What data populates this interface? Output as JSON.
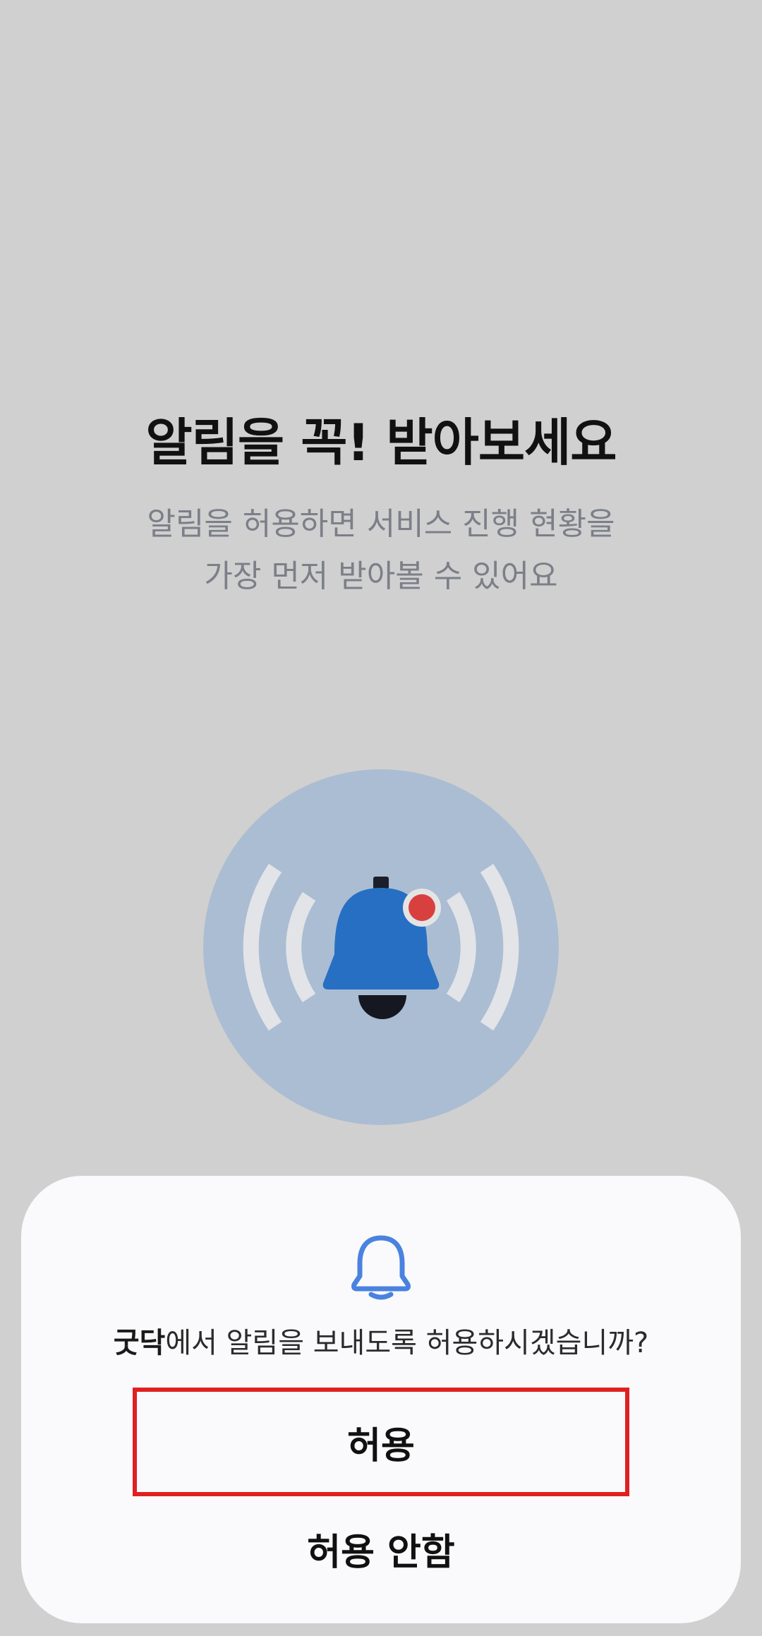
{
  "screen": {
    "title": "알림을 꼭! 받아보세요",
    "subtitle_line1": "알림을 허용하면 서비스 진행 현황을",
    "subtitle_line2": "가장 먼저 받아볼 수 있어요",
    "illustration_icon": "notification-bell-icon"
  },
  "permission_dialog": {
    "icon": "bell-outline-icon",
    "app_name": "굿닥",
    "question_rest": "에서 알림을 보내도록 허용하시겠습니까?",
    "allow_label": "허용",
    "deny_label": "허용 안함"
  },
  "colors": {
    "background": "#d0d0d0",
    "illustration_circle": "#abbdd3",
    "bell_blue": "#276fc2",
    "badge_red": "#d84040",
    "dialog_bg": "#fafafc",
    "dialog_icon": "#4a82e0",
    "highlight_border": "#e02020"
  }
}
